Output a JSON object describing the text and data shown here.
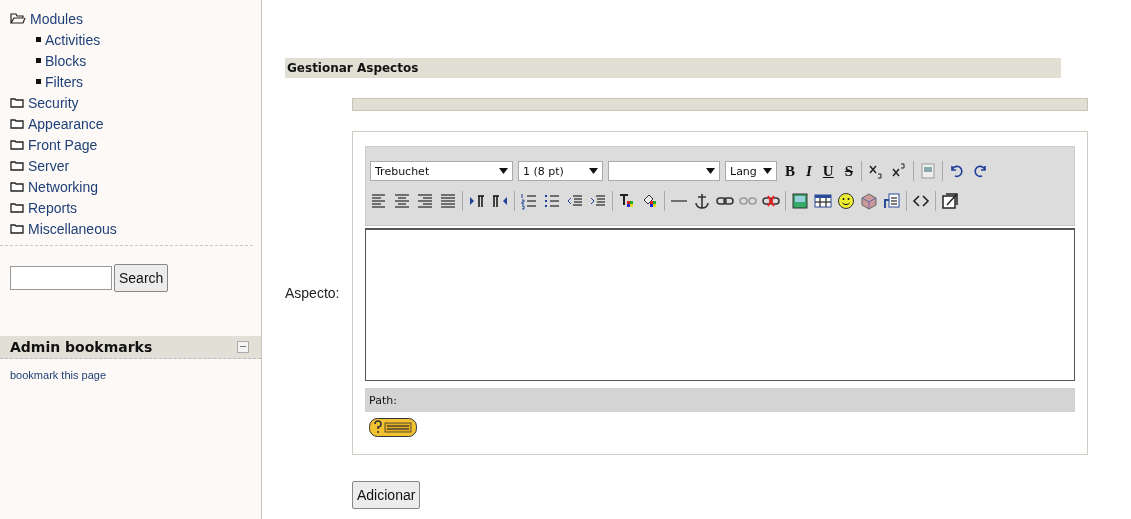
{
  "sidebar": {
    "tree": [
      {
        "label": "Modules",
        "expanded": true,
        "children": [
          {
            "label": "Activities"
          },
          {
            "label": "Blocks"
          },
          {
            "label": "Filters"
          }
        ]
      },
      {
        "label": "Security",
        "expanded": false
      },
      {
        "label": "Appearance",
        "expanded": false
      },
      {
        "label": "Front Page",
        "expanded": false
      },
      {
        "label": "Server",
        "expanded": false
      },
      {
        "label": "Networking",
        "expanded": false
      },
      {
        "label": "Reports",
        "expanded": false
      },
      {
        "label": "Miscellaneous",
        "expanded": false
      }
    ],
    "search_button": "Search",
    "bookmarks": {
      "title": "Admin bookmarks",
      "link": "bookmark this page"
    }
  },
  "main": {
    "heading": "Gestionar Aspectos",
    "field_label": "Aspecto:",
    "editor": {
      "font_select": "Trebuchet",
      "size_select": "1 (8 pt)",
      "lang_select": "Lang",
      "style_buttons": [
        "B",
        "I",
        "U",
        "S"
      ],
      "path_label": "Path:"
    },
    "submit": "Adicionar"
  }
}
